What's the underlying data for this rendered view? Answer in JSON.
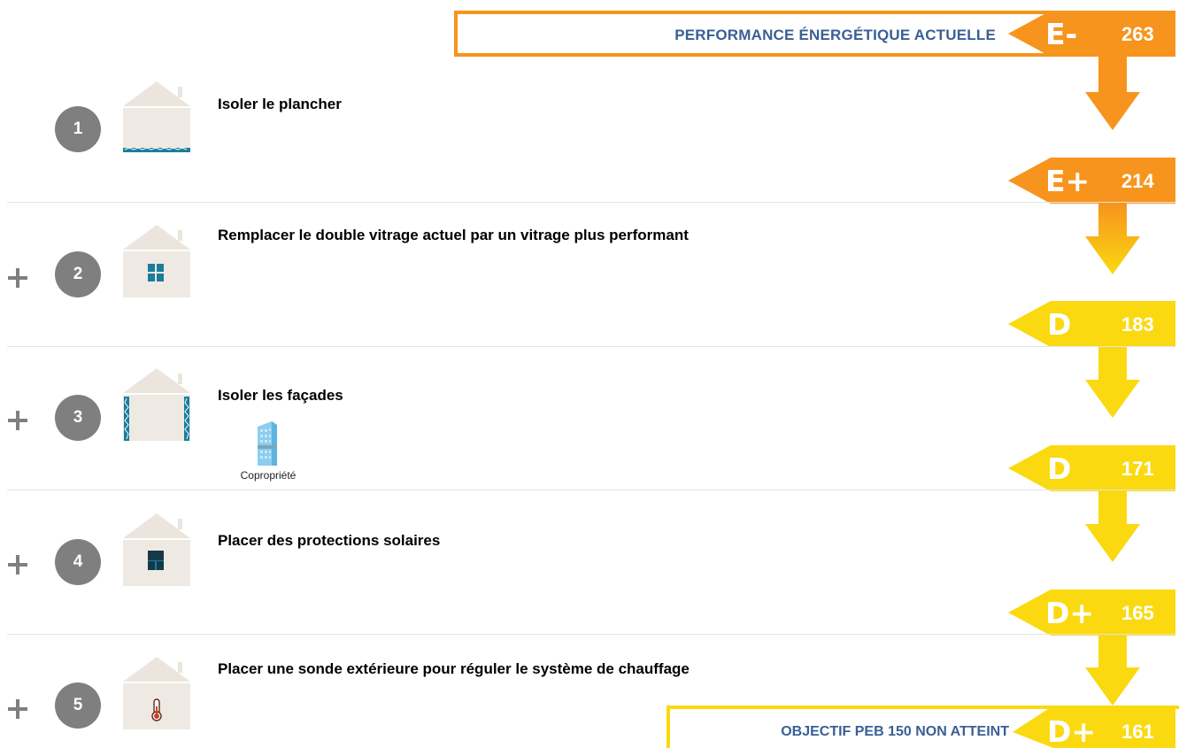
{
  "header": {
    "title": "PERFORMANCE ÉNERGÉTIQUE ACTUELLE"
  },
  "footer": {
    "title": "OBJECTIF PEB 150 NON ATTEINT"
  },
  "ratings": [
    {
      "grade": "E-",
      "value": "263",
      "color": "#f7941d"
    },
    {
      "grade": "E+",
      "value": "214",
      "color": "#f7941d"
    },
    {
      "grade": "D",
      "value": "183",
      "color": "#fbd911"
    },
    {
      "grade": "D",
      "value": "171",
      "color": "#fbd911"
    },
    {
      "grade": "D+",
      "value": "165",
      "color": "#fbd911"
    },
    {
      "grade": "D+",
      "value": "161",
      "color": "#fbd911"
    }
  ],
  "steps": [
    {
      "number": "1",
      "label": "Isoler le plancher",
      "icon": "house-floor-insulation-icon"
    },
    {
      "number": "2",
      "label": "Remplacer le double vitrage actuel par un vitrage plus performant",
      "icon": "house-window-icon"
    },
    {
      "number": "3",
      "label": "Isoler les façades",
      "icon": "house-facade-insulation-icon",
      "badge": "Copropriété"
    },
    {
      "number": "4",
      "label": "Placer des protections solaires",
      "icon": "house-sun-protection-icon"
    },
    {
      "number": "5",
      "label": "Placer une sonde extérieure pour réguler le système de chauffage",
      "icon": "house-thermometer-icon"
    }
  ],
  "colors": {
    "orange": "#f7941d",
    "yellow": "#fbd911",
    "title_blue": "#3a5f94",
    "teal": "#1a7d9c",
    "circle_gray": "#7f7f7f",
    "house_wall": "#efe9e3",
    "house_roof": "#ece5de"
  }
}
